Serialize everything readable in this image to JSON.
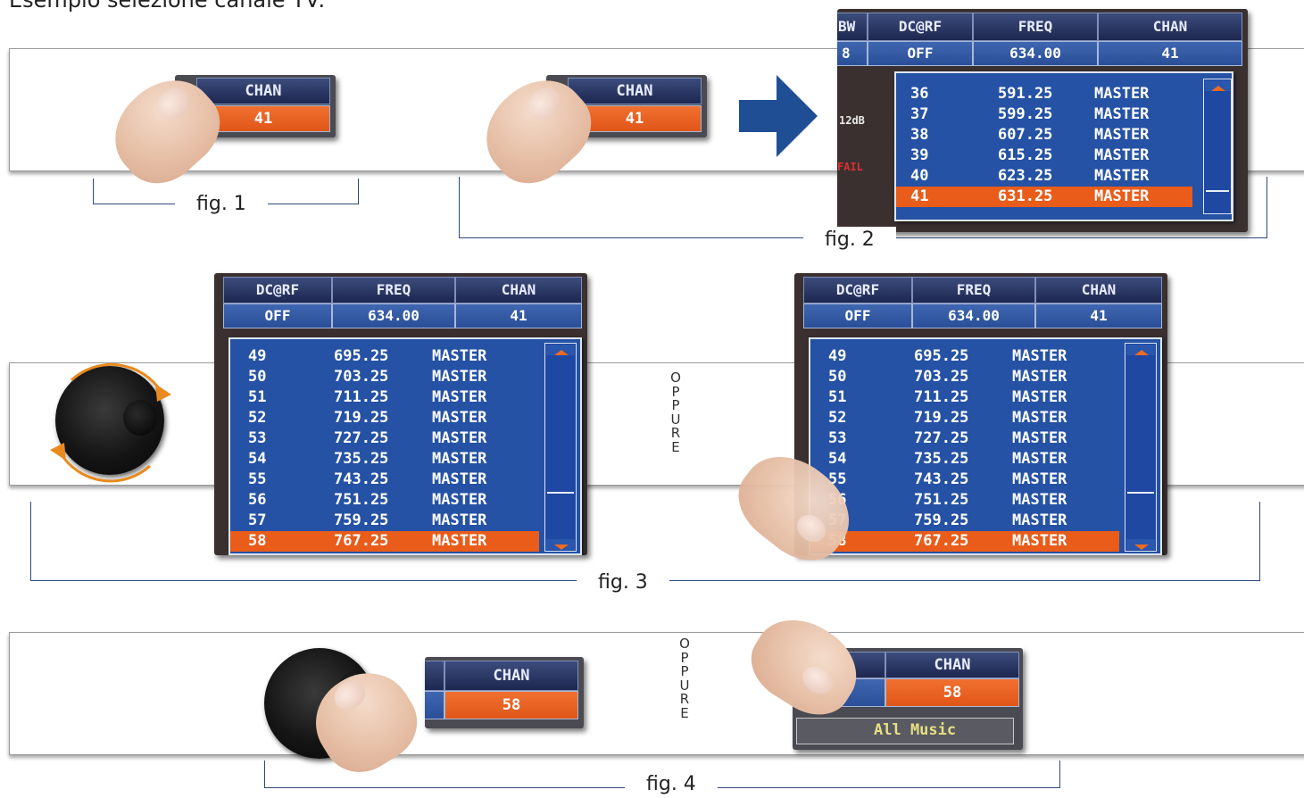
{
  "heading": "Esempio selezione canale TV:",
  "figures": {
    "fig1": "fig. 1",
    "fig2": "fig. 2",
    "fig3": "fig. 3",
    "fig4": "fig. 4"
  },
  "oppure_letters": [
    "O",
    "P",
    "P",
    "U",
    "R",
    "E"
  ],
  "lcd": {
    "chan_label": "CHAN",
    "chan_initial": "41",
    "chan_final": "58",
    "dcrf_label": "DC@RF",
    "dcrf_value": "OFF",
    "freq_label": "FREQ",
    "freq_value": "634.00",
    "bw_label": "BW",
    "bw_value": "8",
    "side_12db": "12dB",
    "side_fail": "FAIL",
    "freq_partial": "REQ",
    "freq_value_partial": "00",
    "all_music": "All Music"
  },
  "list_fig2": [
    {
      "ch": "36",
      "freq": "591.25",
      "mode": "MASTER"
    },
    {
      "ch": "37",
      "freq": "599.25",
      "mode": "MASTER"
    },
    {
      "ch": "38",
      "freq": "607.25",
      "mode": "MASTER"
    },
    {
      "ch": "39",
      "freq": "615.25",
      "mode": "MASTER"
    },
    {
      "ch": "40",
      "freq": "623.25",
      "mode": "MASTER"
    },
    {
      "ch": "41",
      "freq": "631.25",
      "mode": "MASTER"
    }
  ],
  "list_fig3": [
    {
      "ch": "49",
      "freq": "695.25",
      "mode": "MASTER"
    },
    {
      "ch": "50",
      "freq": "703.25",
      "mode": "MASTER"
    },
    {
      "ch": "51",
      "freq": "711.25",
      "mode": "MASTER"
    },
    {
      "ch": "52",
      "freq": "719.25",
      "mode": "MASTER"
    },
    {
      "ch": "53",
      "freq": "727.25",
      "mode": "MASTER"
    },
    {
      "ch": "54",
      "freq": "735.25",
      "mode": "MASTER"
    },
    {
      "ch": "55",
      "freq": "743.25",
      "mode": "MASTER"
    },
    {
      "ch": "56",
      "freq": "751.25",
      "mode": "MASTER"
    },
    {
      "ch": "57",
      "freq": "759.25",
      "mode": "MASTER"
    },
    {
      "ch": "58",
      "freq": "767.25",
      "mode": "MASTER"
    }
  ],
  "colors": {
    "header_navy": "#1d2750",
    "value_blue": "#2a4f98",
    "selected_orange": "#e95c1a",
    "bracket_blue": "#2d4a7a",
    "arrow_blue": "#1f4e94",
    "knob_arrow_orange": "#e88a1e"
  }
}
